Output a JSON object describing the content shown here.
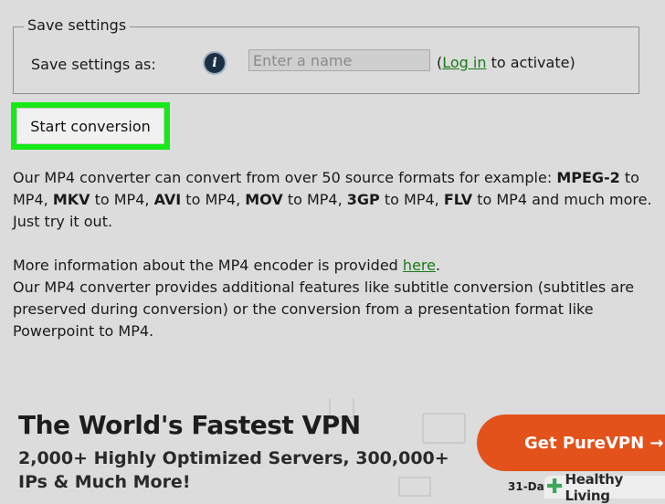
{
  "save_settings": {
    "legend": "Save settings",
    "label": "Save settings as:",
    "name_placeholder": "Enter a name",
    "login_open": "(",
    "login_link": "Log in",
    "login_rest": " to activate)"
  },
  "start_button": "Start conversion",
  "description": {
    "p1": [
      {
        "t": "Our MP4 converter can convert from over 50 source formats for example: ",
        "b": false
      },
      {
        "t": "MPEG-2",
        "b": true
      },
      {
        "t": " to MP4, ",
        "b": false
      },
      {
        "t": "MKV",
        "b": true
      },
      {
        "t": " to MP4, ",
        "b": false
      },
      {
        "t": "AVI",
        "b": true
      },
      {
        "t": " to MP4, ",
        "b": false
      },
      {
        "t": "MOV",
        "b": true
      },
      {
        "t": " to MP4, ",
        "b": false
      },
      {
        "t": "3GP",
        "b": true
      },
      {
        "t": " to MP4, ",
        "b": false
      },
      {
        "t": "FLV",
        "b": true
      },
      {
        "t": " to MP4 and much more. Just try it out.",
        "b": false
      }
    ],
    "p2_pre": "More information about the MP4 encoder is provided ",
    "p2_link": "here",
    "p2_post": ".",
    "p3": "Our MP4 converter provides additional features like subtitle conversion (subtitles are preserved during conversion) or the conversion from a presentation format like Powerpoint to MP4."
  },
  "ad": {
    "headline": "The World's Fastest VPN",
    "subline": "2,000+ Highly Optimized Servers, 300,000+ IPs & Much More!",
    "cta": "Get PureVPN →",
    "date_fragment": "31-Day"
  },
  "watermark": {
    "text": "Healthy Living",
    "icon": "plus-cross-icon",
    "color": "#3aa75a"
  },
  "colors": {
    "highlight": "#17e817",
    "cta": "#e3521b",
    "link": "#1a7a1a"
  }
}
